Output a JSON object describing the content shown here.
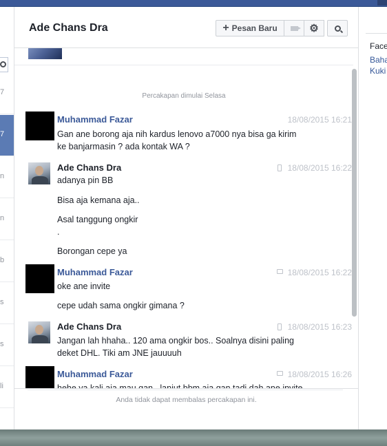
{
  "header": {
    "title": "Ade Chans Dra",
    "new_message_label": "Pesan Baru"
  },
  "left_list": {
    "items": [
      "7",
      "7",
      "n",
      "n",
      "b",
      "s",
      "s",
      "li"
    ]
  },
  "conversation": {
    "start_label": "Percakapan dimulai Selasa",
    "messages": [
      {
        "sender": "Muhammad Fazar",
        "time": "18/08/2015 16:21",
        "source": "none",
        "lines": [
          "Gan ane borong aja nih kardus lenovo a7000 nya bisa ga kirim\nke banjarmasin ? ada kontak WA ?"
        ]
      },
      {
        "sender": "Ade Chans Dra",
        "time": "18/08/2015 16:22",
        "source": "phone-icon",
        "lines": [
          "adanya pin BB",
          "Bisa aja kemana aja..",
          "Asal tanggung ongkir\n.",
          "Borongan cepe ya"
        ]
      },
      {
        "sender": "Muhammad Fazar",
        "time": "18/08/2015 16:22",
        "source": "chat-icon",
        "lines": [
          "oke ane invite",
          "cepe udah sama ongkir gimana ?"
        ]
      },
      {
        "sender": "Ade Chans Dra",
        "time": "18/08/2015 16:23",
        "source": "phone-icon",
        "lines": [
          "Jangan lah hhaha.. 120 ama ongkir bos.. Soalnya disini paling\ndeket DHL. Tiki am JNE jauuuuh"
        ]
      },
      {
        "sender": "Muhammad Fazar",
        "time": "18/08/2015 16:26",
        "source": "chat-icon",
        "lines": [
          "hehe ya kali aja mau gan.. lanjut bbm aja gan tadi dah ane invite"
        ]
      }
    ]
  },
  "footer": {
    "notice": "Anda tidak dapat membalas percakapan ini."
  },
  "right_panel": {
    "title": "Face",
    "links": [
      "Baha",
      "Kuki"
    ]
  },
  "colors": {
    "brand": "#3b5998",
    "sender_link": "#3b5998",
    "active_thread": "#5b7bb4"
  }
}
